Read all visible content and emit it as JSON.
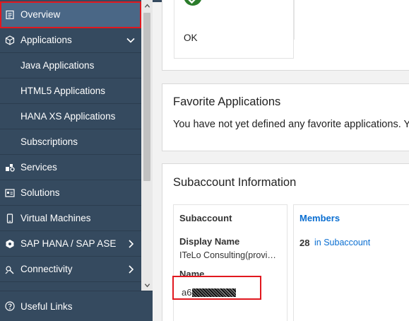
{
  "sidebar": {
    "items": [
      {
        "label": "Overview",
        "icon": "overview-icon",
        "active": true
      },
      {
        "label": "Applications",
        "icon": "applications-icon",
        "expanded": true
      },
      {
        "label": "Java Applications",
        "sub": true
      },
      {
        "label": "HTML5 Applications",
        "sub": true
      },
      {
        "label": "HANA XS Applications",
        "sub": true
      },
      {
        "label": "Subscriptions",
        "sub": true
      },
      {
        "label": "Services",
        "icon": "services-icon"
      },
      {
        "label": "Solutions",
        "icon": "solutions-icon"
      },
      {
        "label": "Virtual Machines",
        "icon": "virtual-machines-icon"
      },
      {
        "label": "SAP HANA / SAP ASE",
        "icon": "database-icon"
      },
      {
        "label": "Connectivity",
        "icon": "connectivity-icon"
      }
    ],
    "footer": {
      "label": "Useful Links",
      "icon": "help-icon"
    }
  },
  "status": {
    "label": "OK",
    "icon": "check-circle-icon"
  },
  "favorites": {
    "title": "Favorite Applications",
    "message": "You have not yet defined any favorite applications. Y"
  },
  "subaccount": {
    "title": "Subaccount Information",
    "sub_heading": "Subaccount",
    "display_name_label": "Display Name",
    "display_name_value": "ITeLo Consulting(provi…",
    "name_label": "Name",
    "name_prefix": "a6",
    "members_heading": "Members",
    "members_count": "28",
    "members_link": "in Subaccount"
  },
  "colors": {
    "sidebar_bg": "#354a5f",
    "active_bg": "#4a6786",
    "highlight": "#e1181f",
    "link": "#0a6ed1",
    "ok_green": "#2b7c2b"
  }
}
